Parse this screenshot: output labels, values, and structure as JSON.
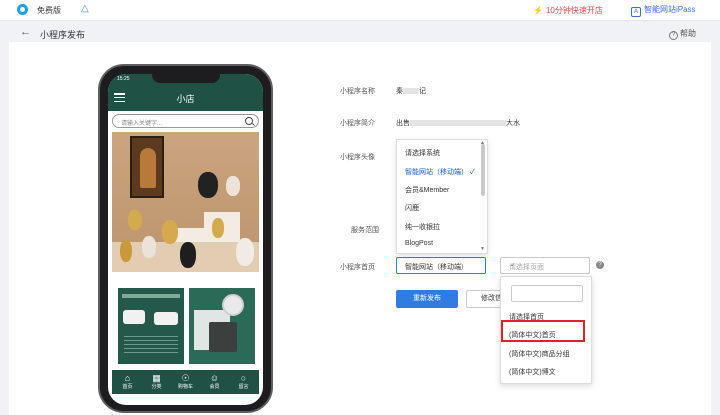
{
  "topbar": {
    "plan_label": "免费版",
    "fast_open": "10分钟快速开店",
    "ipass_label": "智能网站iPass",
    "colors": {
      "accent": "#2f7de1",
      "danger": "#ea4848",
      "brand_green": "#1f5245"
    }
  },
  "page": {
    "back_icon": "back-arrow-icon",
    "title": "小程序发布",
    "help": "帮助"
  },
  "phone": {
    "time": "15:25",
    "app_title": "小店",
    "search_placeholder": "请输入关键字...",
    "tabs": [
      {
        "icon": "home-icon",
        "label": "首页"
      },
      {
        "icon": "grid-icon",
        "label": "分类"
      },
      {
        "icon": "cart-icon",
        "label": "购物车"
      },
      {
        "icon": "user-icon",
        "label": "会员"
      },
      {
        "icon": "chat-icon",
        "label": "留言"
      }
    ]
  },
  "form": {
    "name_label": "小程序名称",
    "name_value_start": "秦",
    "name_value_end": "记",
    "desc_label": "小程序简介",
    "desc_value_start": "出售",
    "desc_value_end": "大水",
    "avatar_label": "小程序头像",
    "scope_label": "服务范围",
    "home_label": "小程序首页",
    "home_select": "智能网站（移动端）",
    "page_select_placeholder": "请选择页面",
    "publish_button": "重新发布",
    "edit_button": "修改信息"
  },
  "dropdown_system": {
    "items": [
      "请选择系统",
      "智能网站（移动端）",
      "会员&Member",
      "闪鹿",
      "纯一收银拉",
      "BlogPost"
    ],
    "selected_index": 1
  },
  "dropdown_page": {
    "items": [
      "请选择首页",
      "(简体中文)首页",
      "(简体中文)商品分组",
      "(简体中文)博文"
    ],
    "highlighted_index": 1
  }
}
